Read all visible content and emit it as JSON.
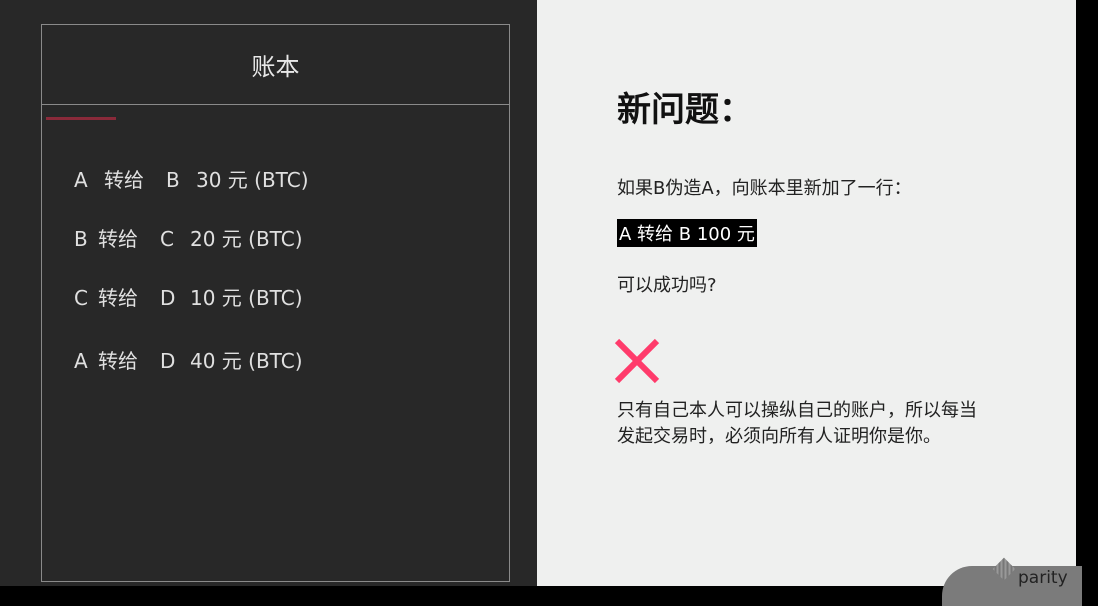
{
  "ledger": {
    "title": "账本",
    "rows": [
      {
        "from": "A",
        "verb": "转给",
        "to": "B",
        "amount": "30 元 (BTC)"
      },
      {
        "from": "B",
        "verb": "转给",
        "to": "C",
        "amount": "20 元 (BTC)"
      },
      {
        "from": "C",
        "verb": "转给",
        "to": "D",
        "amount": "10 元 (BTC)"
      },
      {
        "from": "A",
        "verb": "转给",
        "to": "D",
        "amount": "40 元 (BTC)"
      }
    ]
  },
  "content": {
    "title": "新问题：",
    "scenario": "如果B伪造A，向账本里新加了一行：",
    "forged_line": "A 转给 B 100 元",
    "question": "可以成功吗?",
    "answer_icon": "cross-icon",
    "answer_color": "#ff3b6b",
    "explanation": "只有自己本人可以操纵自己的账户，所以每当发起交易时，必须向所有人证明你是你。"
  },
  "logo": {
    "text": "parity"
  }
}
